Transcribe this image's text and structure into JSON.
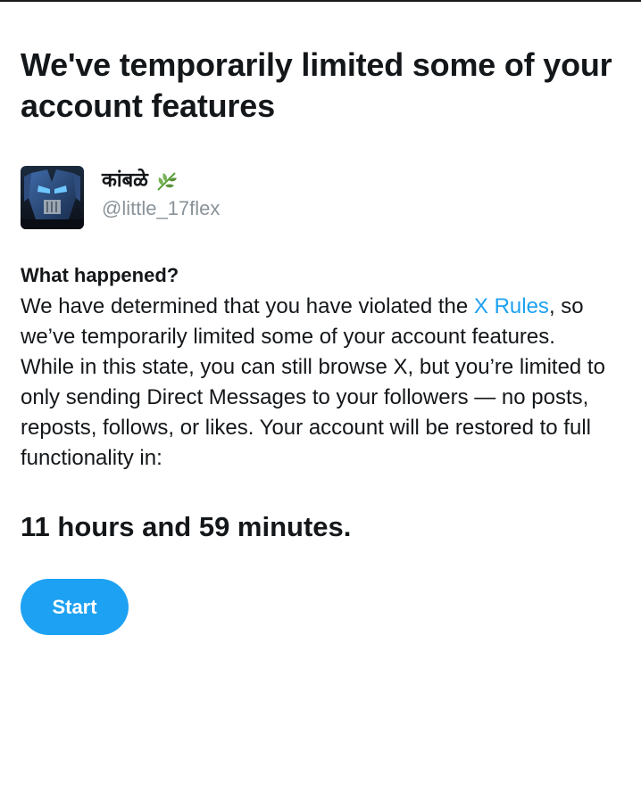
{
  "title": "We've temporarily limited some of your account features",
  "profile": {
    "display_name": "कांबळे",
    "leaf_icon": "herb-icon",
    "handle": "@little_17flex"
  },
  "section": {
    "heading": "What happened?",
    "body_before_link": "We have determined that you have violated the ",
    "link_text": "X Rules",
    "body_after_link": ", so we’ve temporarily limited some of your account features. While in this state, you can still browse X, but you’re limited to only sending Direct Messages to your followers — no posts, reposts, follows, or likes. Your account will be restored to full functionality in:"
  },
  "countdown": "11 hours and 59 minutes.",
  "start_button_label": "Start",
  "colors": {
    "accent": "#1da1f2",
    "text": "#14171a",
    "secondary_text": "#8a9399"
  }
}
